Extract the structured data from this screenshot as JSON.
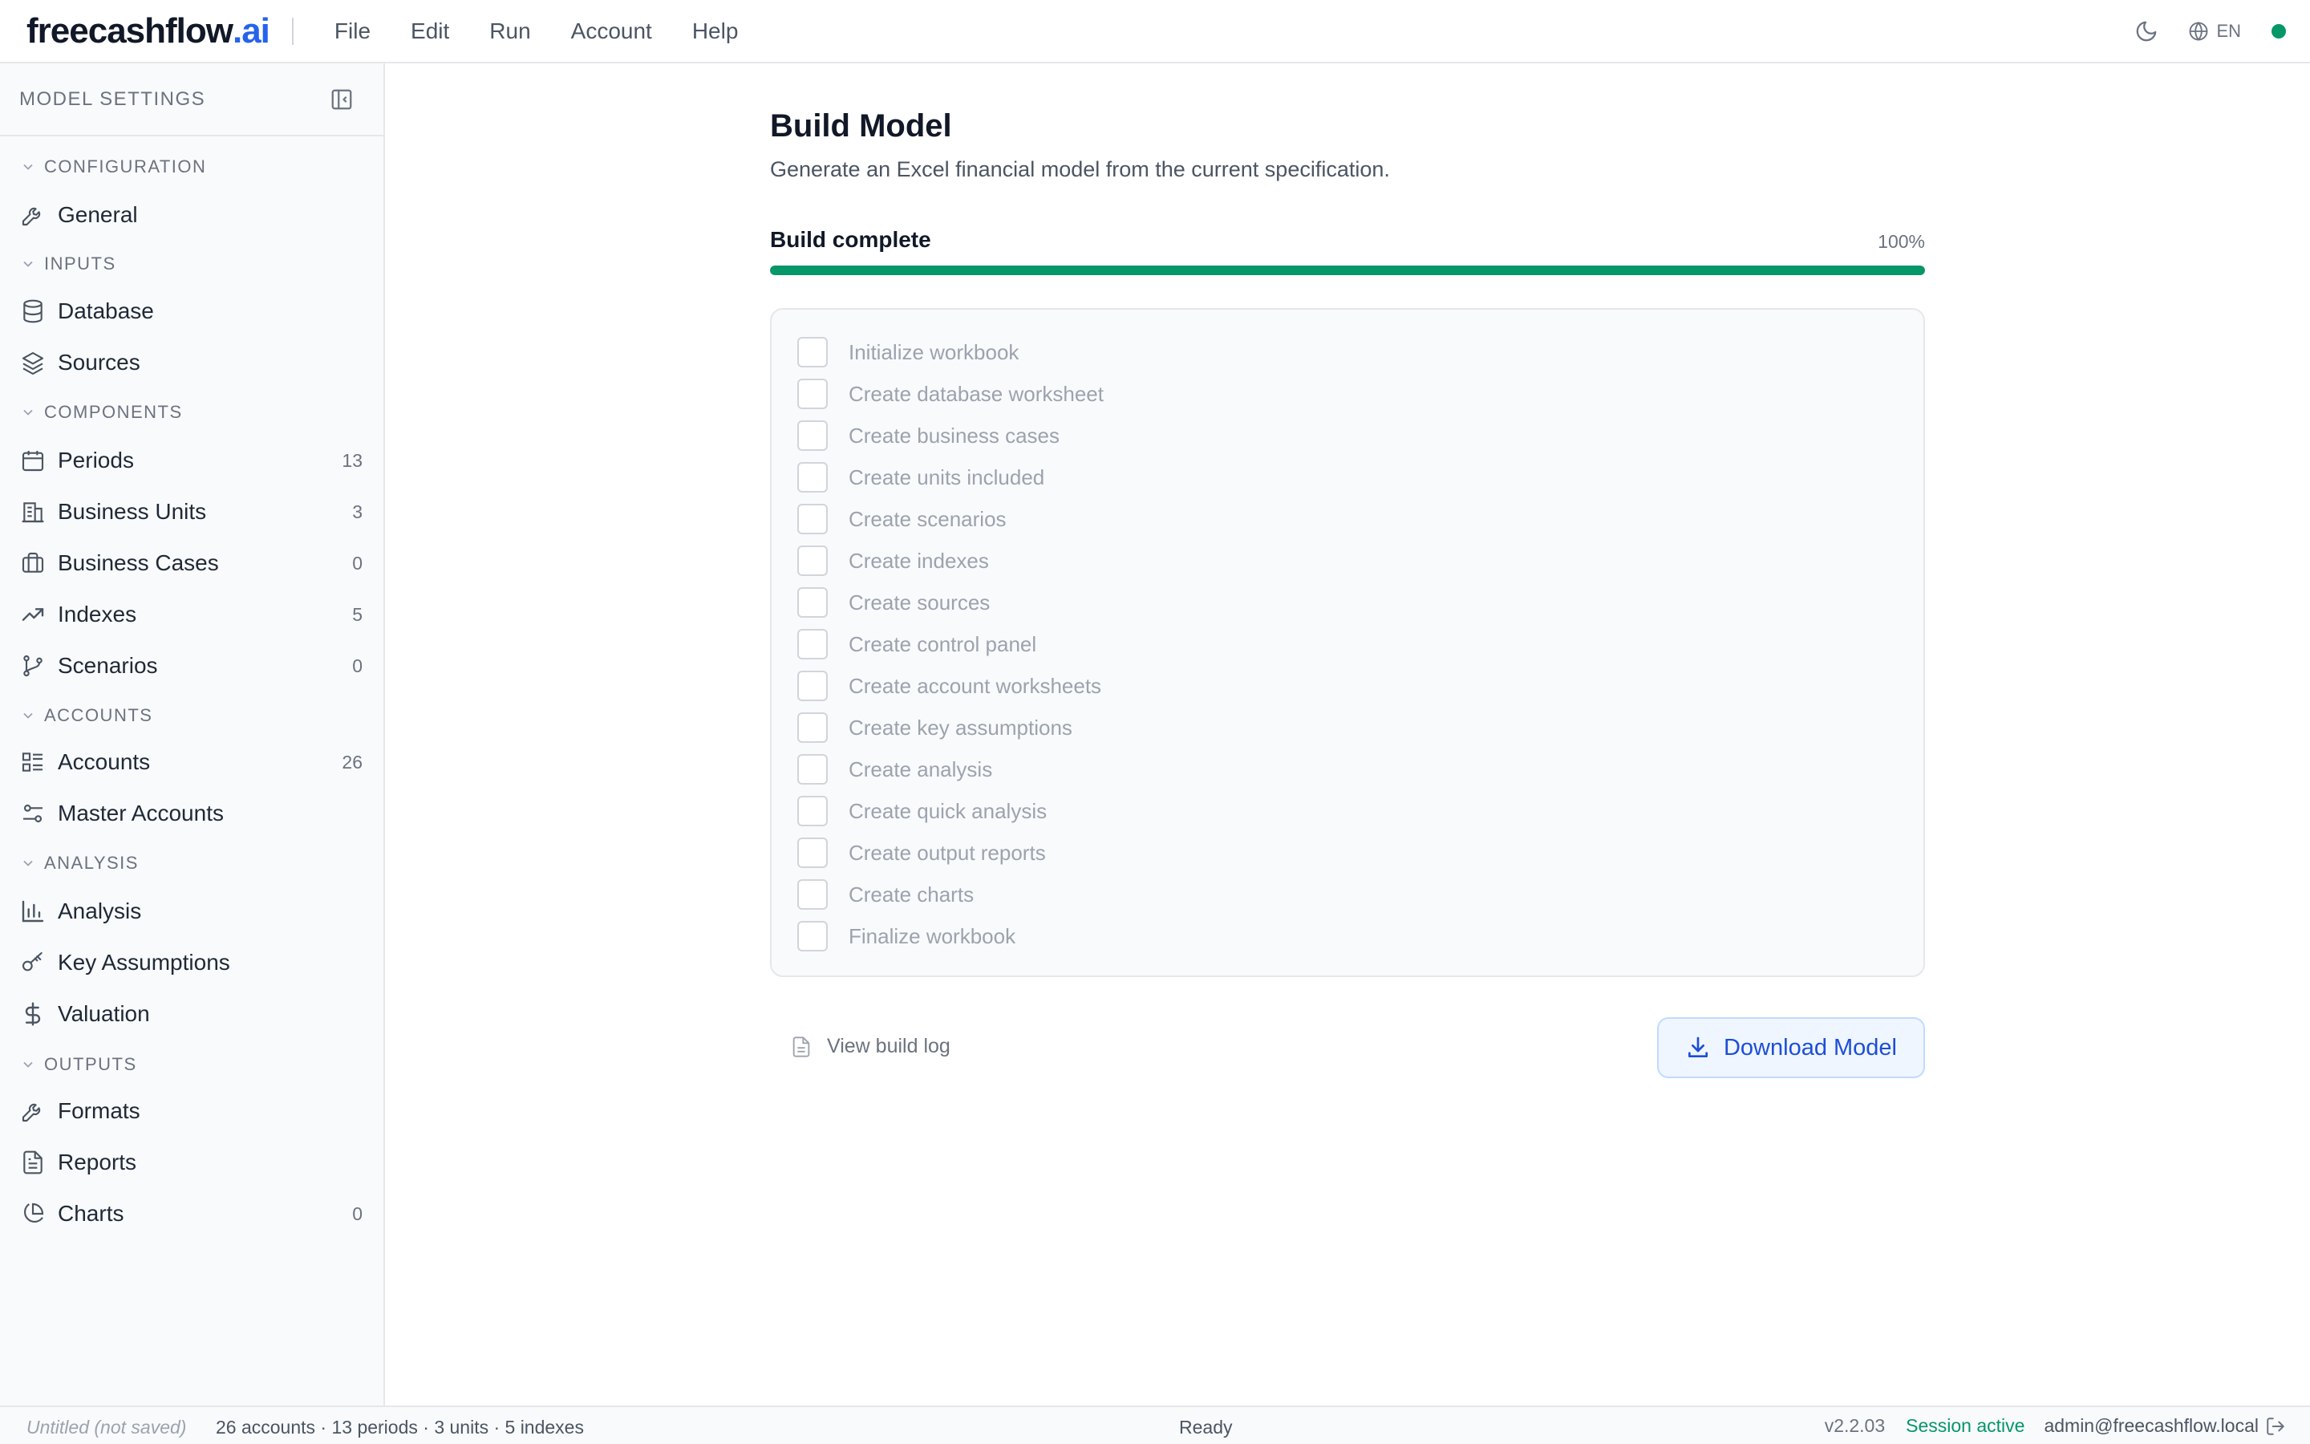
{
  "app": {
    "logo_main": "freecashflow",
    "logo_accent": ".ai",
    "menu": [
      "File",
      "Edit",
      "Run",
      "Account",
      "Help"
    ],
    "language": "EN",
    "status_color": "#059669"
  },
  "sidebar": {
    "title": "MODEL SETTINGS",
    "sections": {
      "configuration": "CONFIGURATION",
      "inputs": "INPUTS",
      "components": "COMPONENTS",
      "accounts": "ACCOUNTS",
      "analysis": "ANALYSIS",
      "outputs": "OUTPUTS"
    },
    "items": {
      "general": {
        "label": "General",
        "icon": "wrench-icon"
      },
      "database": {
        "label": "Database",
        "icon": "database-icon"
      },
      "sources": {
        "label": "Sources",
        "icon": "layers-icon"
      },
      "periods": {
        "label": "Periods",
        "count": "13",
        "icon": "calendar-icon"
      },
      "business_units": {
        "label": "Business Units",
        "count": "3",
        "icon": "building-icon"
      },
      "business_cases": {
        "label": "Business Cases",
        "count": "0",
        "icon": "briefcase-icon"
      },
      "indexes": {
        "label": "Indexes",
        "count": "5",
        "icon": "trending-up-icon"
      },
      "scenarios": {
        "label": "Scenarios",
        "count": "0",
        "icon": "git-branch-icon"
      },
      "accounts": {
        "label": "Accounts",
        "count": "26",
        "icon": "list-icon"
      },
      "master_accounts": {
        "label": "Master Accounts",
        "icon": "sliders-icon"
      },
      "analysis": {
        "label": "Analysis",
        "icon": "bar-chart-icon"
      },
      "key_assumptions": {
        "label": "Key Assumptions",
        "icon": "key-icon"
      },
      "valuation": {
        "label": "Valuation",
        "icon": "dollar-icon"
      },
      "formats": {
        "label": "Formats",
        "icon": "wrench-icon"
      },
      "reports": {
        "label": "Reports",
        "icon": "document-icon"
      },
      "charts": {
        "label": "Charts",
        "count": "0",
        "icon": "pie-chart-icon"
      }
    }
  },
  "main": {
    "title": "Build Model",
    "subtitle": "Generate an Excel financial model from the current specification.",
    "progress_label": "Build complete",
    "progress_percent_text": "100%",
    "progress_value": 1.0,
    "progress_color": "#059669",
    "steps": [
      "Initialize workbook",
      "Create database worksheet",
      "Create business cases",
      "Create units included",
      "Create scenarios",
      "Create indexes",
      "Create sources",
      "Create control panel",
      "Create account worksheets",
      "Create key assumptions",
      "Create analysis",
      "Create quick analysis",
      "Create output reports",
      "Create charts",
      "Finalize workbook"
    ],
    "view_log_label": "View build log",
    "download_label": "Download Model"
  },
  "statusbar": {
    "file": "Untitled (not saved)",
    "summary": "26 accounts · 13 periods · 3 units · 5 indexes",
    "state": "Ready",
    "version": "v2.2.03",
    "session": "Session active",
    "user": "admin@freecashflow.local"
  }
}
